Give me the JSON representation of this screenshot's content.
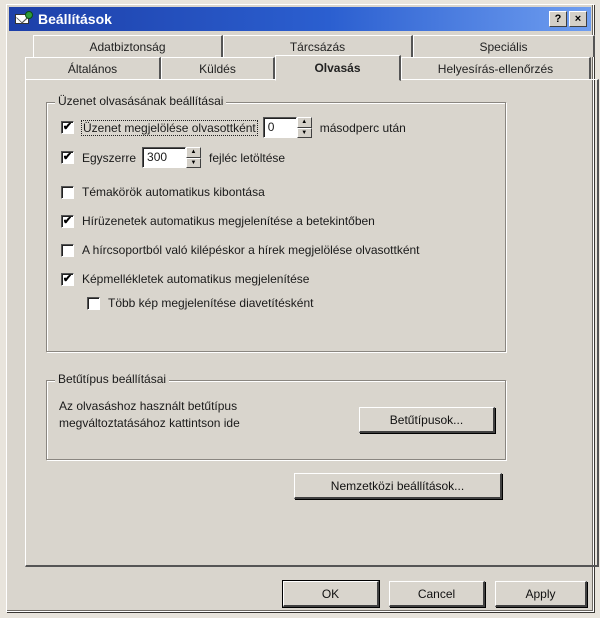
{
  "window": {
    "title": "Beállítások",
    "help_btn": "?",
    "close_btn": "×"
  },
  "tabs_back": [
    "Adatbiztonság",
    "Tárcsázás",
    "Speciális"
  ],
  "tabs_front": [
    "Általános",
    "Küldés",
    "Olvasás",
    "Helyesírás-ellenőrzés"
  ],
  "active_tab": "Olvasás",
  "reading": {
    "group_title": "Üzenet olvasásának beállításai",
    "mark_read": {
      "checked": true,
      "label": "Üzenet megjelölése olvasottként",
      "value": "0",
      "suffix": "másodperc után"
    },
    "download": {
      "checked": true,
      "prefix": "Egyszerre",
      "value": "300",
      "suffix": "fejléc letöltése"
    },
    "auto_expand": {
      "checked": false,
      "label": "Témakörök automatikus kibontása"
    },
    "auto_preview": {
      "checked": true,
      "label": "Hírüzenetek automatikus megjelenítése a betekintőben"
    },
    "mark_on_exit": {
      "checked": false,
      "label": "A hírcsoportból való kilépéskor a hírek megjelölése olvasottként"
    },
    "show_attachments": {
      "checked": true,
      "label": "Képmellékletek automatikus megjelenítése"
    },
    "slideshow": {
      "checked": false,
      "label": "Több kép megjelenítése diavetítésként"
    }
  },
  "fonts": {
    "group_title": "Betűtípus beállításai",
    "description_line1": "Az olvasáshoz használt betűtípus",
    "description_line2": "megváltoztatásához kattintson ide",
    "button": "Betűtípusok..."
  },
  "intl_button": "Nemzetközi beállítások...",
  "footer": {
    "ok": "OK",
    "cancel": "Cancel",
    "apply": "Apply"
  },
  "check_glyph": "✔",
  "colors": {
    "titlebar_start": "#1d3fa8",
    "titlebar_end": "#6f9ef0",
    "dialog_bg": "#d9d5cd"
  }
}
